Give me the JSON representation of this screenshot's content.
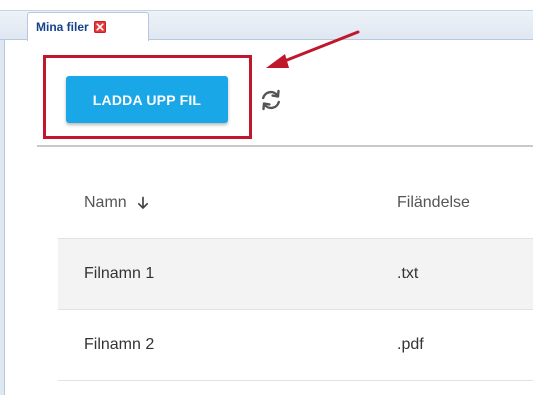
{
  "colors": {
    "accent": "#1aa7e8",
    "highlight": "#c0172d",
    "tab_text": "#15428b",
    "close_icon": "#e4393c"
  },
  "tab": {
    "label": "Mina filer",
    "close_icon": "close-icon"
  },
  "toolbar": {
    "upload_label": "LADDA UPP FIL",
    "refresh_icon": "refresh-icon"
  },
  "table": {
    "columns": [
      {
        "label": "Namn",
        "sort_icon": "arrow-down-icon"
      },
      {
        "label": "Filändelse"
      }
    ],
    "rows": [
      {
        "name": "Filnamn 1",
        "ext": ".txt"
      },
      {
        "name": "Filnamn 2",
        "ext": ".pdf"
      }
    ]
  }
}
